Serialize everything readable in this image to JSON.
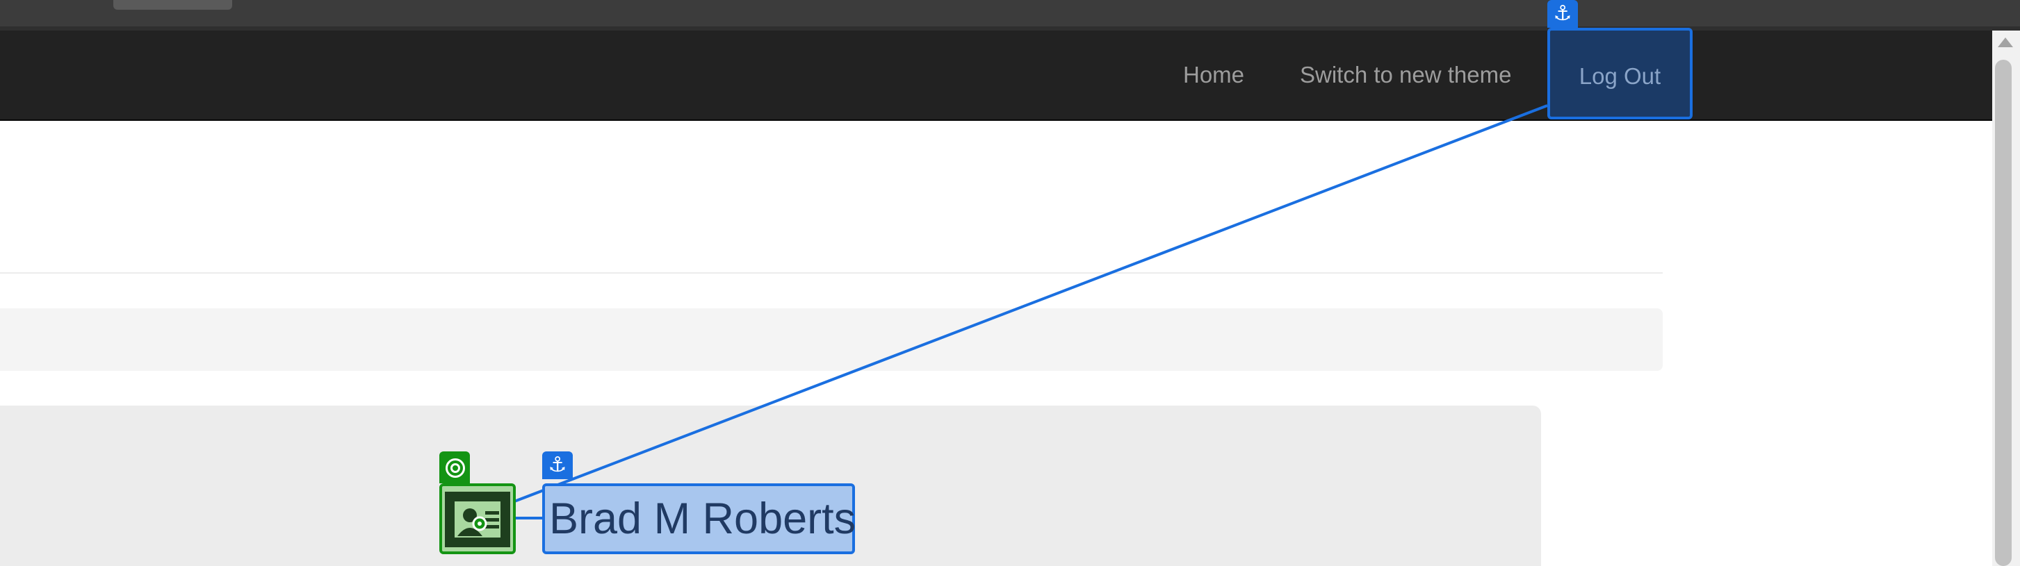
{
  "navbar": {
    "home_label": "Home",
    "theme_label": "Switch to new theme",
    "logout_label": "Log Out"
  },
  "annotations": {
    "anchor_glyph": "⚓",
    "anchor_color": "#1a6fe0",
    "target_color": "#149414",
    "icons": [
      "anchor-icon",
      "target-icon",
      "id-card-icon"
    ]
  },
  "profile": {
    "name": "Brad M Roberts"
  }
}
